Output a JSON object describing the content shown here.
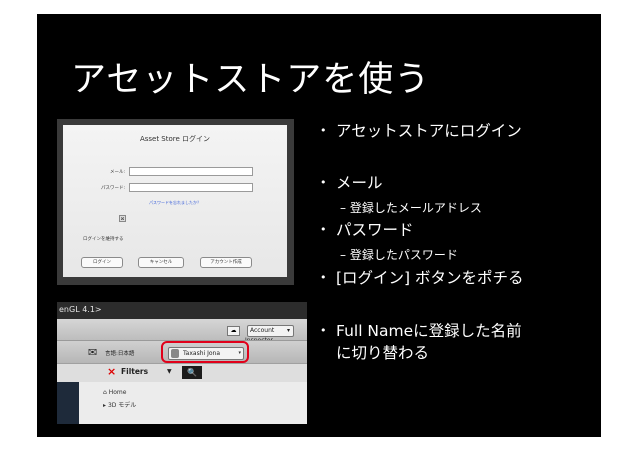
{
  "slide": {
    "title": "アセットストアを使う",
    "bullets": [
      {
        "text": "アセットストアにログイン"
      },
      {
        "text": "メール",
        "sub": "– 登録したメールアドレス"
      },
      {
        "text": "パスワード",
        "sub": "– 登録したパスワード"
      },
      {
        "text": "[ログイン] ボタンをポチる"
      },
      {
        "text": "Full Nameに登録した名前に切り替わる",
        "line1": "Full Nameに登録した名前",
        "line2": "に切り替わる"
      }
    ],
    "bullet_glyph": "•"
  },
  "login_dialog": {
    "title": "Asset Store ログイン",
    "email_label": "メール:",
    "password_label": "パスワード:",
    "forgot_link": "パスワードを忘れましたか？",
    "checkbox_mark": "☒",
    "keep_logged_in": "ログインを維持する",
    "buttons": [
      "ログイン",
      "キャンセル",
      "アカウント作成"
    ]
  },
  "unity_toolbar": {
    "window_title": "enGL 4.1>",
    "cloud_icon": "☁",
    "account_label": "Account",
    "account_dropdown": "▾",
    "inspector_tab": "Inspector",
    "mail_icon": "✉",
    "language": "言語:日本語",
    "user_name": "Taxashi Jona",
    "user_dropdown": "▾",
    "clear_icon": "×",
    "filters_label": "Filters",
    "filters_dropdown": "▼",
    "search_icon": "🔍",
    "tree": [
      {
        "icon": "⌂",
        "label": "Home"
      },
      {
        "icon": "▸",
        "label": "3D モデル"
      }
    ],
    "highlight_color": "#e1001a"
  }
}
